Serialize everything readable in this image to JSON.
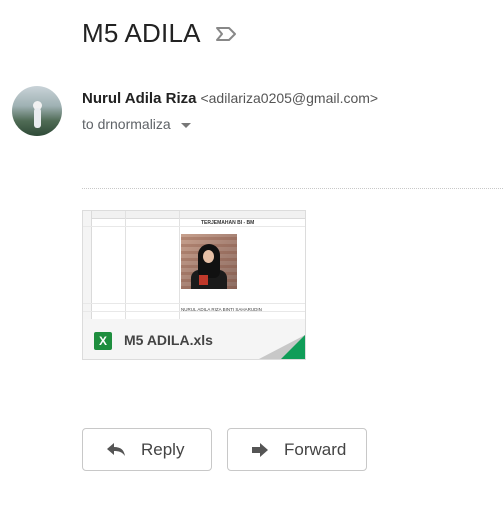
{
  "subject": "M5 ADILA",
  "sender": {
    "name": "Nurul Adila Riza",
    "email": "<adilariza0205@gmail.com>",
    "to_line": "to drnormaliza"
  },
  "attachment": {
    "filename": "M5 ADILA.xls",
    "type_badge": "X",
    "preview_title": "TERJEMAHAN BI - BM",
    "preview_caption": "NURUL ADILA RIZA BINTI SAHARUDIN"
  },
  "actions": {
    "reply_label": "Reply",
    "forward_label": "Forward"
  },
  "colors": {
    "excel_green": "#1e8e3e",
    "corner_green": "#0f9d58"
  }
}
